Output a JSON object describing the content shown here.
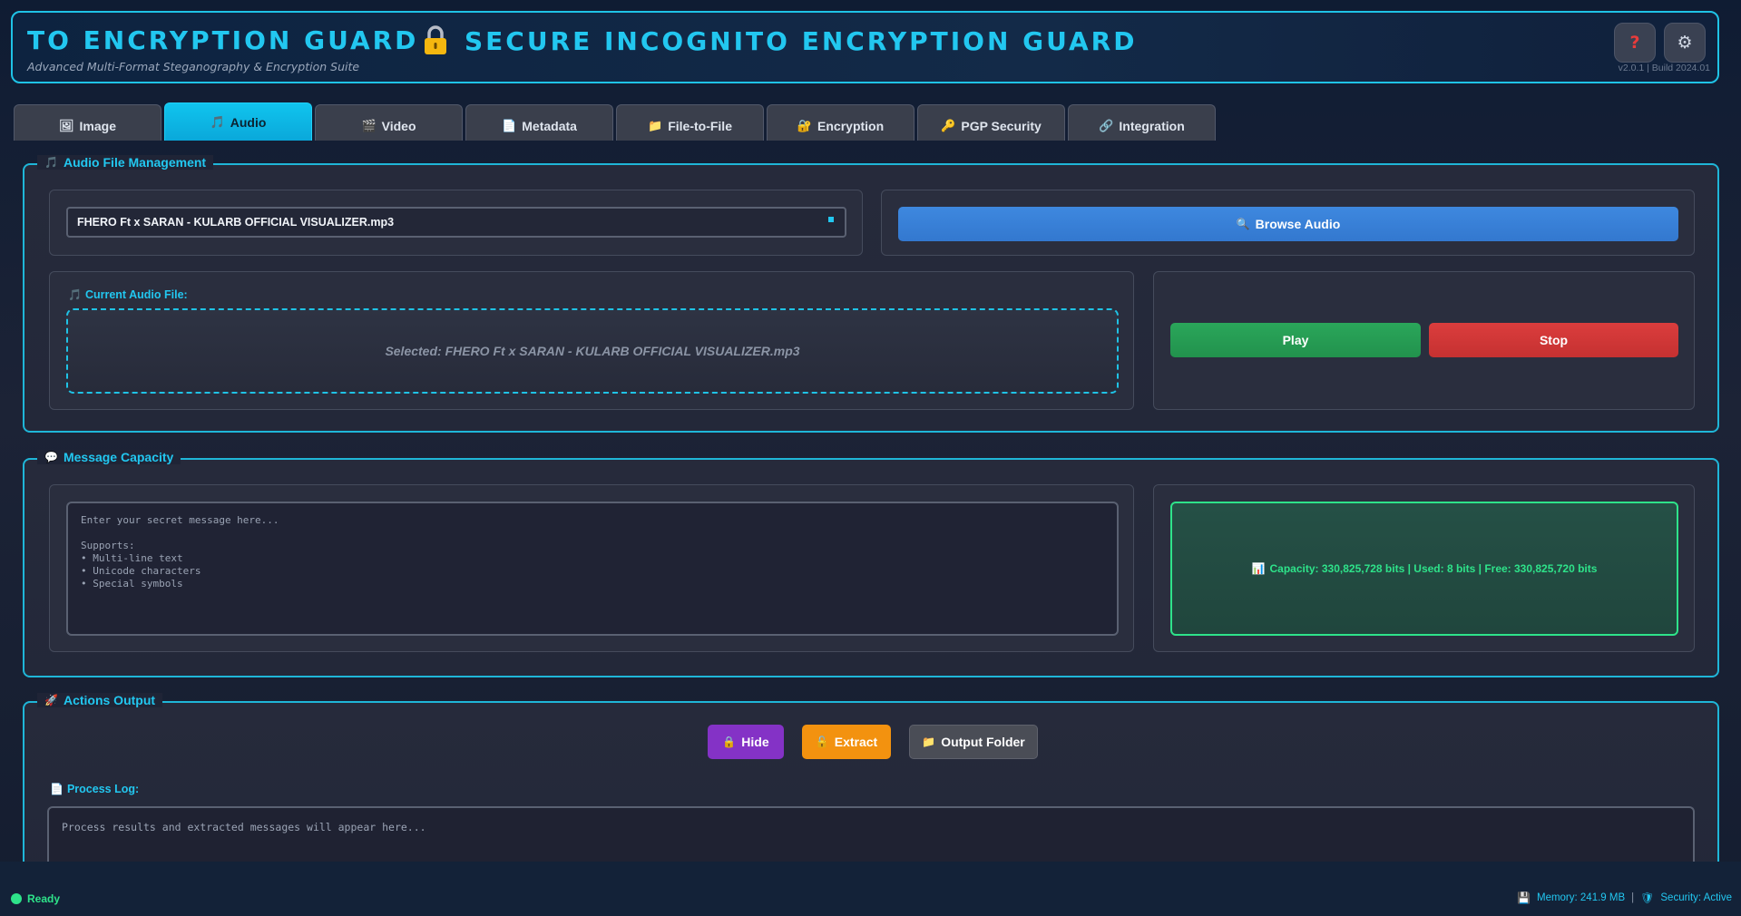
{
  "header": {
    "title_left": "TO ENCRYPTION GUARD",
    "subtitle": "Advanced Multi-Format Steganography & Encryption Suite",
    "title_main": "SECURE INCOGNITO ENCRYPTION GUARD",
    "help_label": "?",
    "settings_label": "⚙",
    "version": "v2.0.1 | Build 2024.01",
    "icons": {
      "lock": "lock-icon",
      "help": "help-icon",
      "settings": "gear-icon"
    }
  },
  "tabs": [
    {
      "label": "Image",
      "icon": "🖼",
      "active": false
    },
    {
      "label": "Audio",
      "icon": "🎵",
      "active": true
    },
    {
      "label": "Video",
      "icon": "🎬",
      "active": false
    },
    {
      "label": "Metadata",
      "icon": "📄",
      "active": false
    },
    {
      "label": "File-to-File",
      "icon": "📁",
      "active": false
    },
    {
      "label": "Encryption",
      "icon": "🔐",
      "active": false
    },
    {
      "label": "PGP Security",
      "icon": "🔑",
      "active": false
    },
    {
      "label": "Integration",
      "icon": "🔗",
      "active": false
    }
  ],
  "audio_panel": {
    "legend": "Audio File Management",
    "legend_icon": "🎵",
    "file_value": "FHERO Ft   x SARAN -  KULARB OFFICIAL VISUALIZER.mp3",
    "browse_label": "Browse Audio",
    "browse_icon": "🔍",
    "current_label": "Current Audio File:",
    "current_icon": "🎵",
    "selected_text": "Selected: FHERO Ft   x SARAN -  KULARB OFFICIAL VISUALIZER.mp3",
    "play_label": "Play",
    "stop_label": "Stop"
  },
  "message_panel": {
    "legend": "Message  Capacity",
    "legend_icon": "💬",
    "placeholder": "Enter your secret message here...\n\nSupports:\n• Multi-line text\n• Unicode characters\n• Special symbols",
    "capacity_icon": "📊",
    "capacity_text": "Capacity: 330,825,728 bits | Used: 8 bits | Free: 330,825,720 bits"
  },
  "actions_panel": {
    "legend": "Actions  Output",
    "legend_icon": "🚀",
    "hide_label": "Hide",
    "hide_icon": "🔒",
    "extract_label": "Extract",
    "extract_icon": "🔓",
    "output_label": "Output Folder",
    "output_icon": "📁",
    "log_label": "Process Log:",
    "log_icon": "📄",
    "log_placeholder": "Process results and extracted messages will appear here..."
  },
  "status": {
    "ready": "Ready",
    "memory": "Memory: 241.9 MB",
    "memory_icon": "💾",
    "separator": "|",
    "security": "Security: Active",
    "security_icon": "🛡"
  },
  "colors": {
    "accent": "#22c7f0",
    "success": "#2ee38a",
    "browse": "#3a82da",
    "play": "#26a055",
    "stop": "#d33838",
    "hide": "#8432c6",
    "extract": "#f3920f"
  }
}
